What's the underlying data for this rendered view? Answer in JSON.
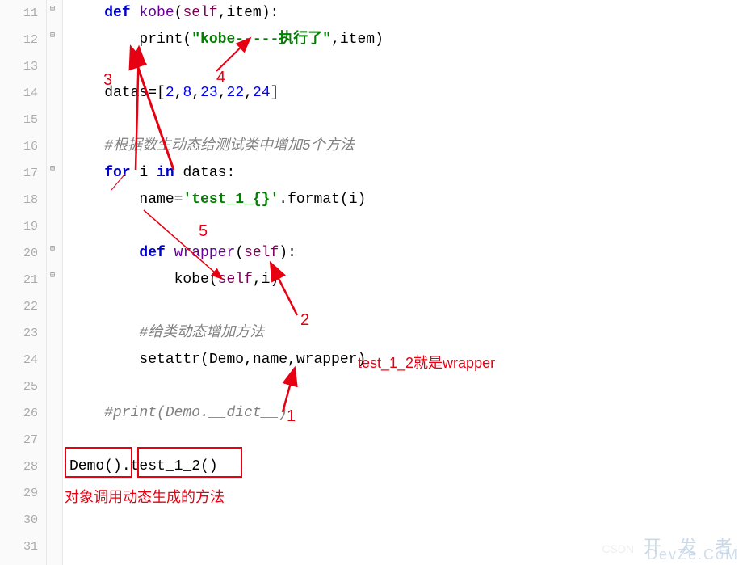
{
  "lineNumbers": [
    "11",
    "12",
    "13",
    "14",
    "15",
    "16",
    "17",
    "18",
    "19",
    "20",
    "21",
    "22",
    "23",
    "24",
    "25",
    "26",
    "27",
    "28",
    "29",
    "30",
    "31"
  ],
  "code": {
    "l11": {
      "indent": "    ",
      "kw": "def ",
      "fn": "kobe",
      "p1": "(",
      "self": "self",
      "p2": ",item):"
    },
    "l12": {
      "indent": "        ",
      "fn": "print(",
      "str": "\"kobe-----执行了\"",
      "p2": ",item)"
    },
    "l14": {
      "indent": "    ",
      "var": "datas",
      "eq": "=[",
      "n1": "2",
      "c1": ",",
      "n2": "8",
      "c2": ",",
      "n3": "23",
      "c3": ",",
      "n4": "22",
      "c4": ",",
      "n5": "24",
      "end": "]"
    },
    "l16": {
      "indent": "    ",
      "cmt": "#根据数生动态给测试类中增加5个方法"
    },
    "l17": {
      "indent": "    ",
      "kw1": "for ",
      "var": "i ",
      "kw2": "in ",
      "name": "datas",
      ":": ":"
    },
    "l18": {
      "indent": "        ",
      "var": "name",
      "eq": "=",
      "str": "'test_1_{}'",
      "dot": ".format(i)"
    },
    "l20": {
      "indent": "        ",
      "kw": "def ",
      "fn": "wrapper",
      "p1": "(",
      "self": "self",
      "p2": "):"
    },
    "l21": {
      "indent": "            ",
      "fn": "kobe(",
      "self": "self",
      "p2": ",i)"
    },
    "l23": {
      "indent": "        ",
      "cmt": "#给类动态增加方法"
    },
    "l24": {
      "indent": "        ",
      "fn": "setattr(Demo,name,wrapper)"
    },
    "l26": {
      "indent": "    ",
      "cmt": "#print(Demo.__dict__)"
    },
    "l28": {
      "indent": "",
      "p1": "Demo()",
      "dot": ".",
      "p2": "test_1_2()"
    }
  },
  "annotations": {
    "n1": "1",
    "n2": "2",
    "n3": "3",
    "n4": "4",
    "n5": "5",
    "wrapper_note": "test_1_2就是wrapper",
    "bottom_note": "对象调用动态生成的方法"
  },
  "watermark": {
    "top": "开 发 者",
    "bottom": "DevZe.CoM",
    "csdn": "CSDN"
  }
}
